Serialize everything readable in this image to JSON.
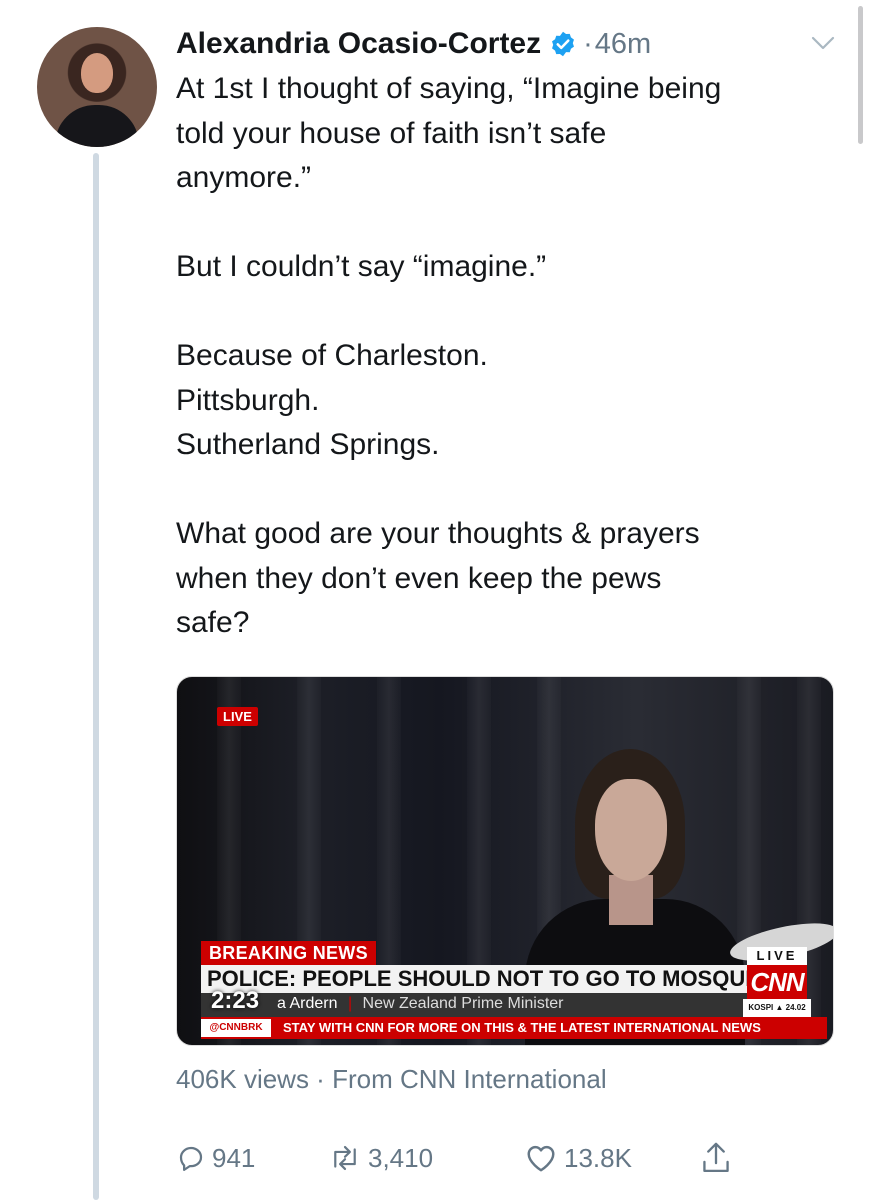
{
  "tweet": {
    "author_name": "Alexandria Ocasio-Cortez",
    "separator": "·",
    "time": "46m",
    "lines": [
      "At 1st I thought of saying, “Imagine being",
      "told your house of faith isn’t safe",
      "anymore.”",
      "",
      "But I couldn’t say “imagine.”",
      "",
      "Because of Charleston.",
      "Pittsburgh.",
      "Sutherland Springs.",
      "",
      "What good are your thoughts & prayers",
      "when they don’t even keep the pews",
      "safe?"
    ]
  },
  "video": {
    "live_badge": "LIVE",
    "breaking_label": "BREAKING NEWS",
    "headline": "POLICE: PEOPLE SHOULD NOT TO GO TO MOSQUES",
    "lower_name": "a Ardern",
    "lower_divider": "|",
    "lower_title": "New Zealand Prime Minister",
    "ticker_handle": "@CNNBRK",
    "ticker_text": "STAY WITH CNN FOR MORE ON THIS & THE LATEST INTERNATIONAL NEWS",
    "live_box": "LIVE",
    "network_logo": "CNN",
    "market": "KOSPI ▲ 24.02",
    "duration": "2:23"
  },
  "meta": {
    "views": "406K views · From CNN International"
  },
  "actions": {
    "replies": "941",
    "retweets": "3,410",
    "likes": "13.8K"
  },
  "colors": {
    "verified": "#1da1f2",
    "secondary_text": "#657786",
    "cnn_red": "#cc0000"
  },
  "icons": [
    "verified-badge-icon",
    "chevron-down-icon",
    "reply-icon",
    "retweet-icon",
    "like-icon",
    "share-icon"
  ]
}
